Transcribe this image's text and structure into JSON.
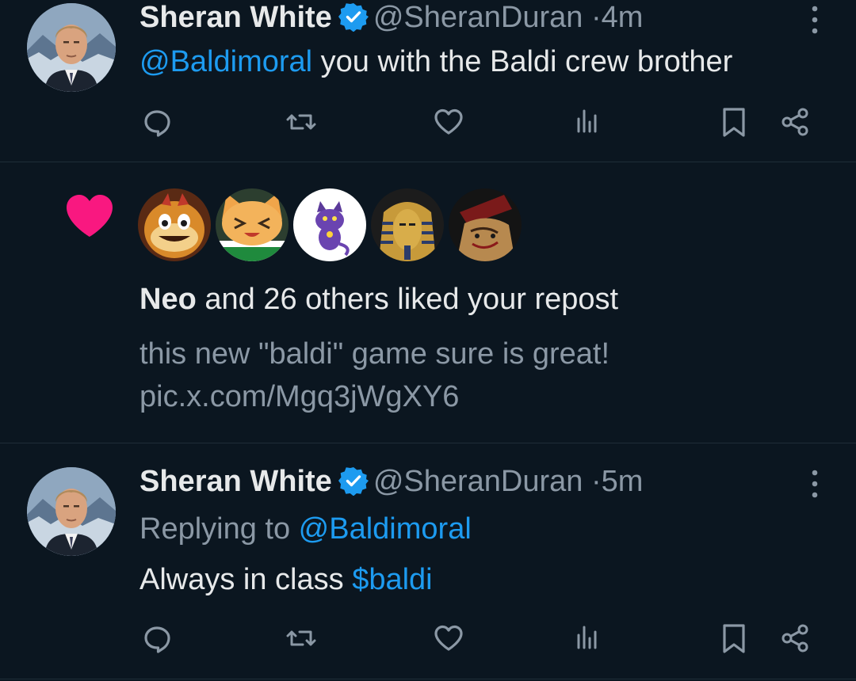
{
  "tweet1": {
    "name": "Sheran White",
    "handle": "@SheranDuran",
    "dot": "·",
    "time": "4m",
    "mention": "@Baldimoral",
    "text": " you with the Baldi crew brother"
  },
  "notification": {
    "actor": "Neo",
    "action": " and 26 others liked your repost",
    "post_line1": "this new \"baldi\" game sure is great!",
    "post_line2": "pic.x.com/Mgq3jWgXY6",
    "avatars": [
      "orange-creature-avatar",
      "cartoon-cat-avatar",
      "purple-cat-avatar",
      "pharaoh-mask-avatar",
      "scribbled-character-avatar"
    ]
  },
  "tweet2": {
    "name": "Sheran White",
    "handle": "@SheranDuran",
    "dot": "·",
    "time": "5m",
    "replying_prefix": "Replying to ",
    "replying_to": "@Baldimoral",
    "text": "Always in class ",
    "cashtag": "$baldi"
  },
  "icons": {
    "reply": "reply-icon",
    "repost": "repost-icon",
    "like": "like-icon",
    "views": "views-icon",
    "bookmark": "bookmark-icon",
    "share": "share-icon",
    "more": "more-icon",
    "verified": "verified-badge-icon"
  },
  "colors": {
    "background": "#0b1620",
    "link": "#1d9bf0",
    "muted": "#8b98a5",
    "like_pink": "#f91880"
  }
}
